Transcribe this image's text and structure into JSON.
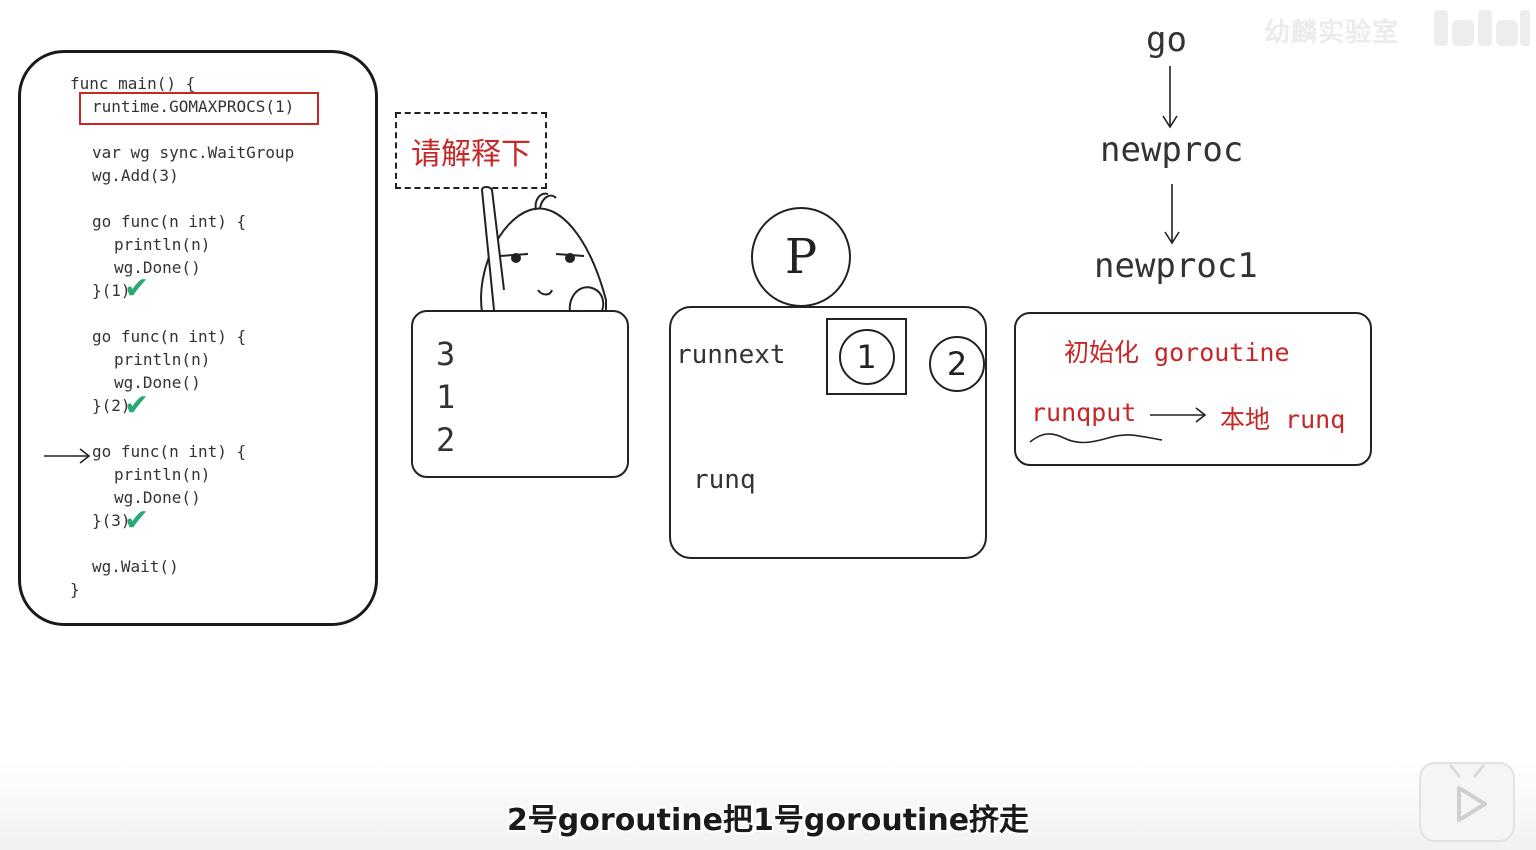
{
  "watermark": {
    "text": "幼麟实验室",
    "icon": "bilibili-logo"
  },
  "code_panel": {
    "lines": {
      "func_main": "func main() {",
      "gomaxprocs": "runtime.GOMAXPROCS(1)",
      "var_wg": "var wg sync.WaitGroup",
      "wg_add": "wg.Add(3)",
      "go_func_1": "go func(n int) {",
      "println_1": "println(n)",
      "done_1": "wg.Done()",
      "close_1": "}(1)",
      "go_func_2": "go func(n int) {",
      "println_2": "println(n)",
      "done_2": "wg.Done()",
      "close_2": "}(2)",
      "go_func_3": "go func(n int) {",
      "println_3": "println(n)",
      "done_3": "wg.Done()",
      "close_3": "}(3)",
      "wg_wait": "wg.Wait()",
      "close_main": "}"
    },
    "highlight_color": "#c62828",
    "check_color": "#2aa876",
    "check_icon": "checkmark-icon"
  },
  "character": {
    "speech": "请解释下",
    "output": [
      "3",
      "1",
      "2"
    ]
  },
  "processor": {
    "label": "P",
    "runnext_label": "runnext",
    "runnext_goroutine": "1",
    "incoming_goroutine": "2",
    "runq_label": "runq"
  },
  "call_flow": {
    "steps": [
      "go",
      "newproc",
      "newproc1"
    ],
    "detail": {
      "init": "初始化 goroutine",
      "runqput": "runqput",
      "target": "本地 runq"
    },
    "accent_color": "#c62828"
  },
  "subtitle": "2号goroutine把1号goroutine挤走",
  "player": {
    "icon": "bilibili-tv-icon"
  }
}
